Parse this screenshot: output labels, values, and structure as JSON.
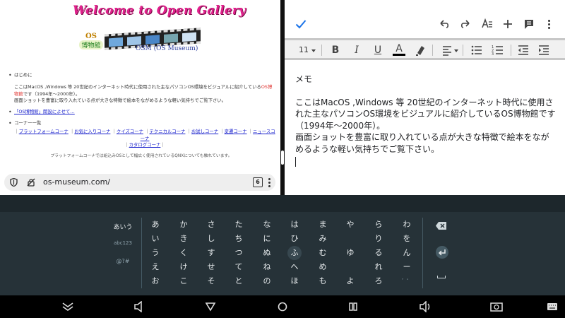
{
  "browser": {
    "site_title": "Welcome to Open Gallery",
    "logo_os": "OS",
    "logo_kanji": "博物館",
    "logo_label": "OSM (OS Museum)",
    "sections": [
      {
        "heading": "はじめに"
      },
      {
        "heading": "コーナー一覧"
      }
    ],
    "intro_before": "ここはMacOS ,Windows 等 20世紀のインターネット時代に使用された主なパソコンOS環境をビジュアルに紹介している",
    "intro_red": "OS博物館",
    "intro_after": "です（1994年～2000年）。",
    "intro_line2": "画面ショットを豊富に取り入れている点が大きな特徴で絵本をながめるような軽い気持ちでご覧下さい。",
    "link_text": "「OS博物館」開設によせて…",
    "corner_links": [
      "プラットフォームコーナ",
      "お気に入りコーナ",
      "クイズコーナ",
      "テクニカルコーナ",
      "お試しコーナ",
      "変遷コーナ",
      "ニュースコーナ",
      "カタログコーナ"
    ],
    "footer_note": "プラットフォームコーナでは組込みOSとして幅広く使用されているQNXについても触れています。",
    "url": "os-museum.com/",
    "tab_count": "6"
  },
  "doc": {
    "font_size": "11",
    "title": "メモ",
    "paragraph1": "ここはMacOS ,Windows 等 20世紀のインターネット時代に使用された主なパソコンOS環境をビジュアルに紹介しているOS博物館です（1994年～2000年）。",
    "paragraph2": "画面ショットを豊富に取り入れている点が大きな特徴で絵本をながめるような軽い気持ちでご覧下さい。"
  },
  "keyboard": {
    "modes": [
      "あいう",
      "abc123",
      "@?#"
    ],
    "rows": [
      [
        "あ",
        "か",
        "さ",
        "た",
        "な",
        "は",
        "ま",
        "や",
        "ら",
        "わ"
      ],
      [
        "い",
        "き",
        "し",
        "ち",
        "に",
        "ひ",
        "み",
        "",
        "り",
        "を"
      ],
      [
        "う",
        "く",
        "す",
        "つ",
        "ぬ",
        "ふ",
        "む",
        "ゆ",
        "る",
        "ん"
      ],
      [
        "え",
        "け",
        "せ",
        "て",
        "ね",
        "へ",
        "め",
        "",
        "れ",
        "ー"
      ],
      [
        "お",
        "こ",
        "そ",
        "と",
        "の",
        "ほ",
        "も",
        "よ",
        "ろ",
        "゛゜"
      ]
    ]
  },
  "colors": {
    "title_pink": "#e0208c",
    "link_blue": "#1a22cc",
    "accent_blue": "#1a73e8",
    "keyboard_bg": "#263238"
  }
}
